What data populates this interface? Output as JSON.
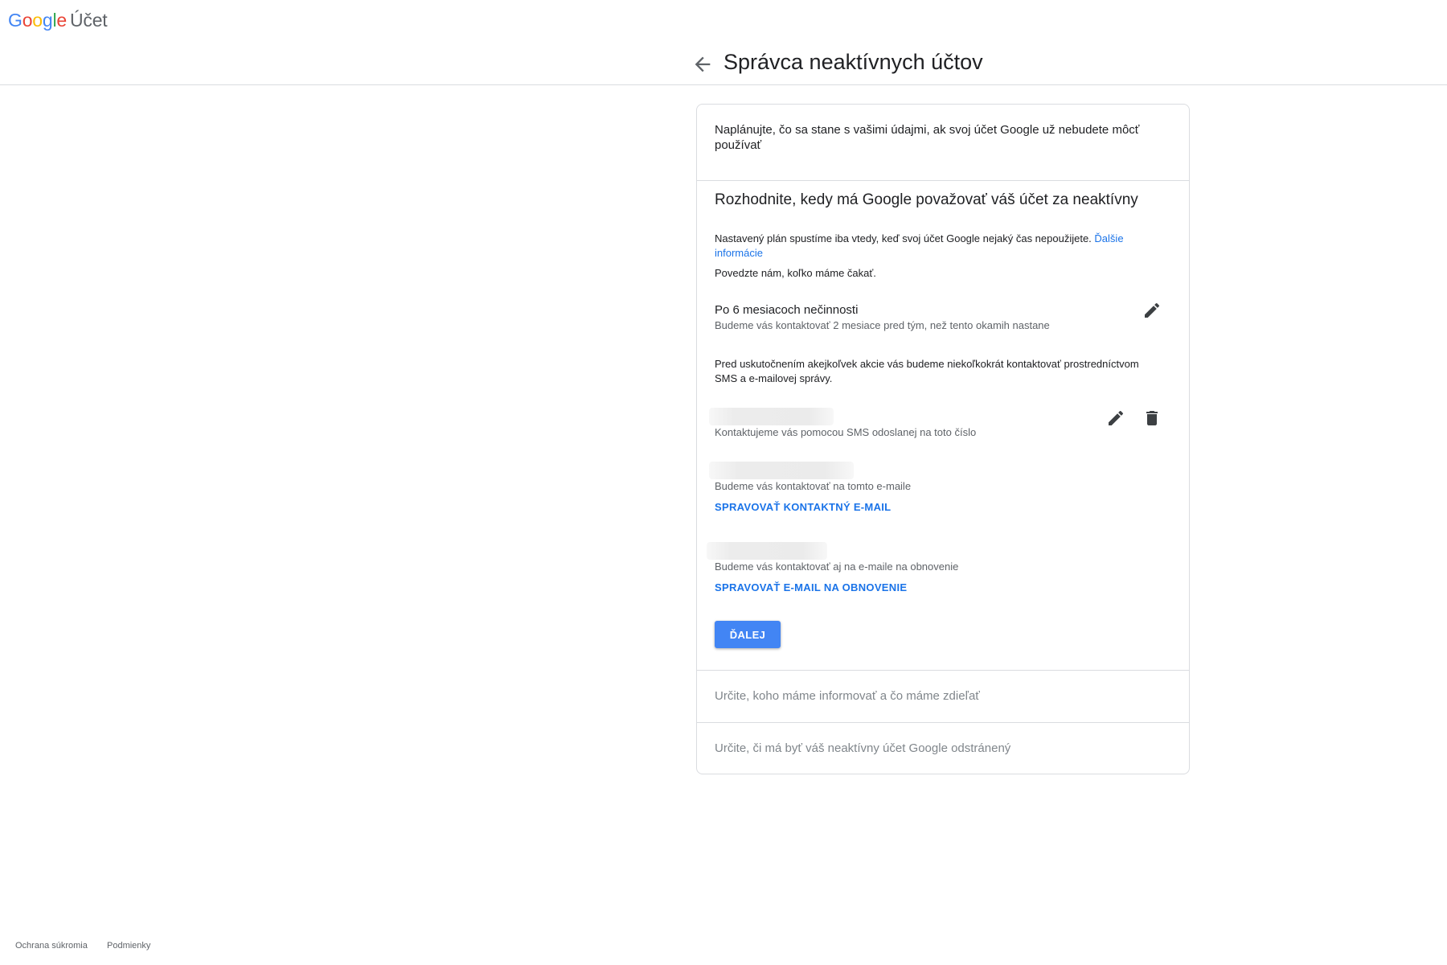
{
  "header": {
    "logo_letters": [
      "G",
      "o",
      "o",
      "g",
      "l",
      "e"
    ],
    "product_name": "Účet",
    "page_title": "Správca neaktívnych účtov"
  },
  "card": {
    "intro": "Naplánujte, čo sa stane s vašimi údajmi, ak svoj účet Google už nebudete môcť používať",
    "section_title": "Rozhodnite, kedy má Google považovať váš účet za neaktívny",
    "plan_note": "Nastavený plán spustíme iba vtedy, keď svoj účet Google nejaký čas nepoužijete.",
    "learn_more": "Ďalšie informácie",
    "wait_prompt": "Povedzte nám, koľko máme čakať.",
    "timeout": {
      "title": "Po 6 mesiacoch nečinnosti",
      "subtitle": "Budeme vás kontaktovať 2 mesiace pred tým, než tento okamih nastane"
    },
    "contact_note": "Pred uskutočnením akejkoľvek akcie vás budeme niekoľkokrát kontaktovať prostredníctvom SMS a e-mailovej správy.",
    "phone": {
      "subtitle": "Kontaktujeme vás pomocou SMS odoslanej na toto číslo"
    },
    "contact_email": {
      "subtitle": "Budeme vás kontaktovať na tomto e-maile",
      "action": "SPRAVOVAŤ KONTAKTNÝ E-MAIL"
    },
    "recovery_email": {
      "subtitle": "Budeme vás kontaktovať aj na e-maile na obnovenie",
      "action": "SPRAVOVAŤ E-MAIL NA OBNOVENIE"
    },
    "next_button": "ĎALEJ",
    "step2_title": "Určite, koho máme informovať a čo máme zdieľať",
    "step3_title": "Určite, či má byť váš neaktívny účet Google odstránený"
  },
  "footer": {
    "privacy": "Ochrana súkromia",
    "terms": "Podmienky"
  },
  "colors": {
    "accent": "#1a73e8",
    "button": "#4285f4",
    "border": "#dadce0",
    "muted_text": "#5f6368"
  },
  "icons": {
    "back": "arrow-back-icon",
    "edit": "pencil-icon",
    "delete": "trash-icon"
  }
}
